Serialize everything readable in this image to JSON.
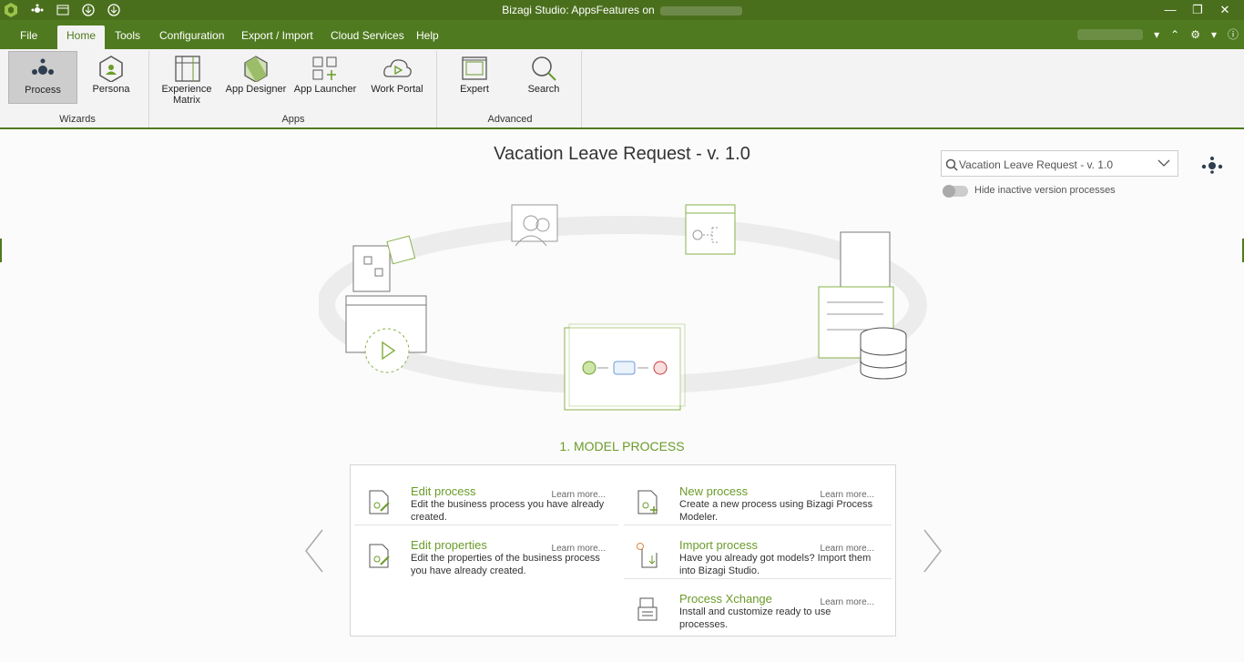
{
  "titlebar": {
    "title": "Bizagi Studio: AppsFeatures  on"
  },
  "menu": {
    "tabs": [
      "File",
      "Home",
      "Tools",
      "Configuration",
      "Export / Import",
      "Cloud Services",
      "Help"
    ]
  },
  "ribbon": {
    "buttons": {
      "process": "Process",
      "persona": "Persona",
      "experience_matrix": "Experience Matrix",
      "app_designer": "App Designer",
      "app_launcher": "App Launcher",
      "work_portal": "Work Portal",
      "expert": "Expert",
      "search": "Search"
    },
    "groups": {
      "wizards": "Wizards",
      "apps": "Apps",
      "advanced": "Advanced"
    }
  },
  "main": {
    "title": "Vacation Leave Request - v. 1.0",
    "version_select": "Vacation Leave Request - v. 1.0",
    "toggle_label": "Hide inactive version processes",
    "section_title": "1. MODEL PROCESS",
    "learn_more": "Learn more...",
    "items": [
      {
        "title": "Edit process",
        "desc": "Edit the business process you have already created."
      },
      {
        "title": "New process",
        "desc": "Create a new process using Bizagi Process Modeler."
      },
      {
        "title": "Edit properties",
        "desc": "Edit the properties of the business process you have already created."
      },
      {
        "title": "Import process",
        "desc": "Have you already got models? Import them into Bizagi Studio."
      },
      {
        "title": "Process Xchange",
        "desc": "Install and customize ready to use processes."
      }
    ]
  },
  "colors": {
    "brand": "#4f7a1f",
    "accent": "#6b9b2a",
    "muted": "#f3f3f3"
  }
}
